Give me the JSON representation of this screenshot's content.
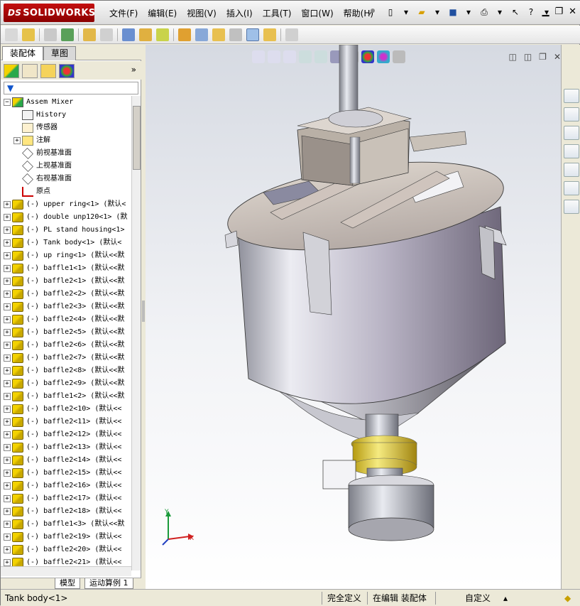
{
  "app": {
    "logo_text": "SOLIDWORKS",
    "logo_prefix": "DS"
  },
  "menu": [
    "文件(F)",
    "编辑(E)",
    "视图(V)",
    "插入(I)",
    "工具(T)",
    "窗口(W)",
    "帮助(H)"
  ],
  "panel": {
    "tabs": [
      "装配体",
      "草图"
    ],
    "tree": [
      {
        "label": "Assem Mixer",
        "icon": "assembly-icon",
        "expand": "minus"
      },
      {
        "label": "History",
        "icon": "history-icon",
        "indent": 1
      },
      {
        "label": "传感器",
        "icon": "sensor-icon",
        "indent": 1
      },
      {
        "label": "注解",
        "icon": "annotation-icon",
        "indent": 1,
        "expand": "plus"
      },
      {
        "label": "前视基准面",
        "icon": "plane-icon",
        "indent": 1
      },
      {
        "label": "上视基准面",
        "icon": "plane-icon",
        "indent": 1
      },
      {
        "label": "右视基准面",
        "icon": "plane-icon",
        "indent": 1
      },
      {
        "label": "原点",
        "icon": "origin-icon",
        "indent": 1
      },
      {
        "label": "(-) upper ring<1> (默认<",
        "icon": "part-icon",
        "expand": "plus"
      },
      {
        "label": "(-) double unp120<1> (默",
        "icon": "part-icon",
        "expand": "plus"
      },
      {
        "label": "(-) PL stand housing<1>",
        "icon": "part-icon",
        "expand": "plus"
      },
      {
        "label": "(-) Tank body<1> (默认<",
        "icon": "part-icon",
        "expand": "plus"
      },
      {
        "label": "(-) up ring<1> (默认<<默",
        "icon": "part-icon",
        "expand": "plus"
      },
      {
        "label": "(-) baffle1<1> (默认<<默",
        "icon": "part-icon",
        "expand": "plus"
      },
      {
        "label": "(-) baffle2<1> (默认<<默",
        "icon": "part-icon",
        "expand": "plus"
      },
      {
        "label": "(-) baffle2<2> (默认<<默",
        "icon": "part-icon",
        "expand": "plus"
      },
      {
        "label": "(-) baffle2<3> (默认<<默",
        "icon": "part-icon",
        "expand": "plus"
      },
      {
        "label": "(-) baffle2<4> (默认<<默",
        "icon": "part-icon",
        "expand": "plus"
      },
      {
        "label": "(-) baffle2<5> (默认<<默",
        "icon": "part-icon",
        "expand": "plus"
      },
      {
        "label": "(-) baffle2<6> (默认<<默",
        "icon": "part-icon",
        "expand": "plus"
      },
      {
        "label": "(-) baffle2<7> (默认<<默",
        "icon": "part-icon",
        "expand": "plus"
      },
      {
        "label": "(-) baffle2<8> (默认<<默",
        "icon": "part-icon",
        "expand": "plus"
      },
      {
        "label": "(-) baffle2<9> (默认<<默",
        "icon": "part-icon",
        "expand": "plus"
      },
      {
        "label": "(-) baffle1<2> (默认<<默",
        "icon": "part-icon",
        "expand": "plus"
      },
      {
        "label": "(-) baffle2<10> (默认<<",
        "icon": "part-icon",
        "expand": "plus"
      },
      {
        "label": "(-) baffle2<11> (默认<<",
        "icon": "part-icon",
        "expand": "plus"
      },
      {
        "label": "(-) baffle2<12> (默认<<",
        "icon": "part-icon",
        "expand": "plus"
      },
      {
        "label": "(-) baffle2<13> (默认<<",
        "icon": "part-icon",
        "expand": "plus"
      },
      {
        "label": "(-) baffle2<14> (默认<<",
        "icon": "part-icon",
        "expand": "plus"
      },
      {
        "label": "(-) baffle2<15> (默认<<",
        "icon": "part-icon",
        "expand": "plus"
      },
      {
        "label": "(-) baffle2<16> (默认<<",
        "icon": "part-icon",
        "expand": "plus"
      },
      {
        "label": "(-) baffle2<17> (默认<<",
        "icon": "part-icon",
        "expand": "plus"
      },
      {
        "label": "(-) baffle2<18> (默认<<",
        "icon": "part-icon",
        "expand": "plus"
      },
      {
        "label": "(-) baffle1<3> (默认<<默",
        "icon": "part-icon",
        "expand": "plus"
      },
      {
        "label": "(-) baffle2<19> (默认<<",
        "icon": "part-icon",
        "expand": "plus"
      },
      {
        "label": "(-) baffle2<20> (默认<<",
        "icon": "part-icon",
        "expand": "plus"
      },
      {
        "label": "(-) baffle2<21> (默认<<",
        "icon": "part-icon",
        "expand": "plus"
      }
    ],
    "bottom_tabs": [
      "模型",
      "运动算例 1"
    ]
  },
  "status": {
    "selected": "Tank body<1>",
    "definition": "完全定义",
    "mode": "在编辑 装配体",
    "units": "自定义"
  },
  "triad": {
    "x": "X",
    "y": "Y"
  }
}
